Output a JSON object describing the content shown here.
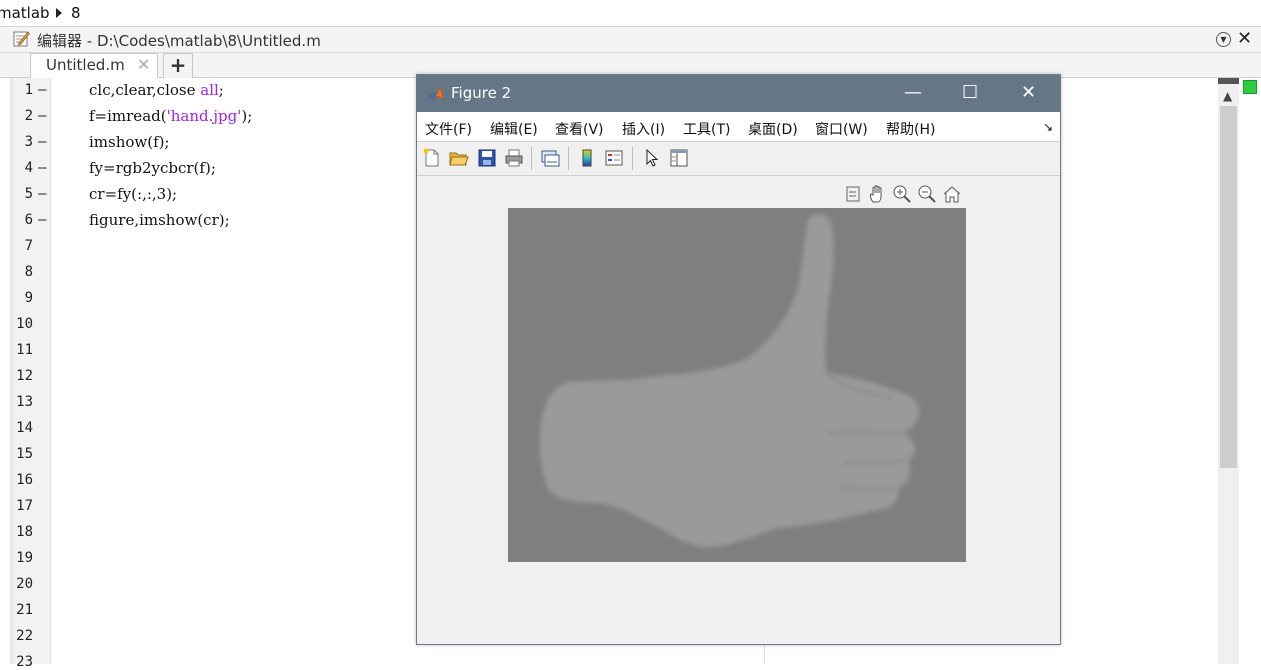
{
  "breadcrumb": {
    "items": [
      "matlab",
      "8"
    ]
  },
  "editor": {
    "title": "编辑器 - D:\\Codes\\matlab\\8\\Untitled.m",
    "tab_label": "Untitled.m",
    "add_tab_label": "+",
    "line_numbers": [
      "1",
      "2",
      "3",
      "4",
      "5",
      "6",
      "7",
      "8",
      "9",
      "10",
      "11",
      "12",
      "13",
      "14",
      "15",
      "16",
      "17",
      "18",
      "19",
      "20",
      "21",
      "22",
      "23"
    ],
    "dash": "—",
    "code_lines": [
      {
        "pre": "clc,clear,close ",
        "str": "all",
        "post": ";"
      },
      {
        "pre": "f=imread(",
        "str": "'hand.jpg'",
        "post": ");"
      },
      {
        "pre": "imshow(f);",
        "str": "",
        "post": ""
      },
      {
        "pre": "fy=rgb2ycbcr(f);",
        "str": "",
        "post": ""
      },
      {
        "pre": "cr=fy(:,:,3);",
        "str": "",
        "post": ""
      },
      {
        "pre": "figure,imshow(cr);",
        "str": "",
        "post": ""
      }
    ]
  },
  "figure": {
    "title": "Figure 2",
    "window_buttons": {
      "minimize": "—",
      "maximize": "☐",
      "close": "✕"
    },
    "menu": [
      "文件(F)",
      "编辑(E)",
      "查看(V)",
      "插入(I)",
      "工具(T)",
      "桌面(D)",
      "窗口(W)",
      "帮助(H)"
    ],
    "menu_overflow": "↘",
    "toolbar_icons": [
      "new-figure-icon",
      "open-file-icon",
      "save-icon",
      "print-icon",
      "link-plot-icon",
      "colorbar-icon",
      "legend-icon",
      "pointer-icon",
      "property-inspector-icon"
    ],
    "axes_toolbar_icons": [
      "brush-icon",
      "pan-hand-icon",
      "zoom-in-icon",
      "zoom-out-icon",
      "home-icon"
    ],
    "image_description_colors": {
      "background": "#7f7f7f",
      "hand": "#9a9a9a"
    }
  },
  "colors": {
    "titlebar": "#657687",
    "string_literal": "#a020f0",
    "status_indicator": "#2ecc40"
  }
}
